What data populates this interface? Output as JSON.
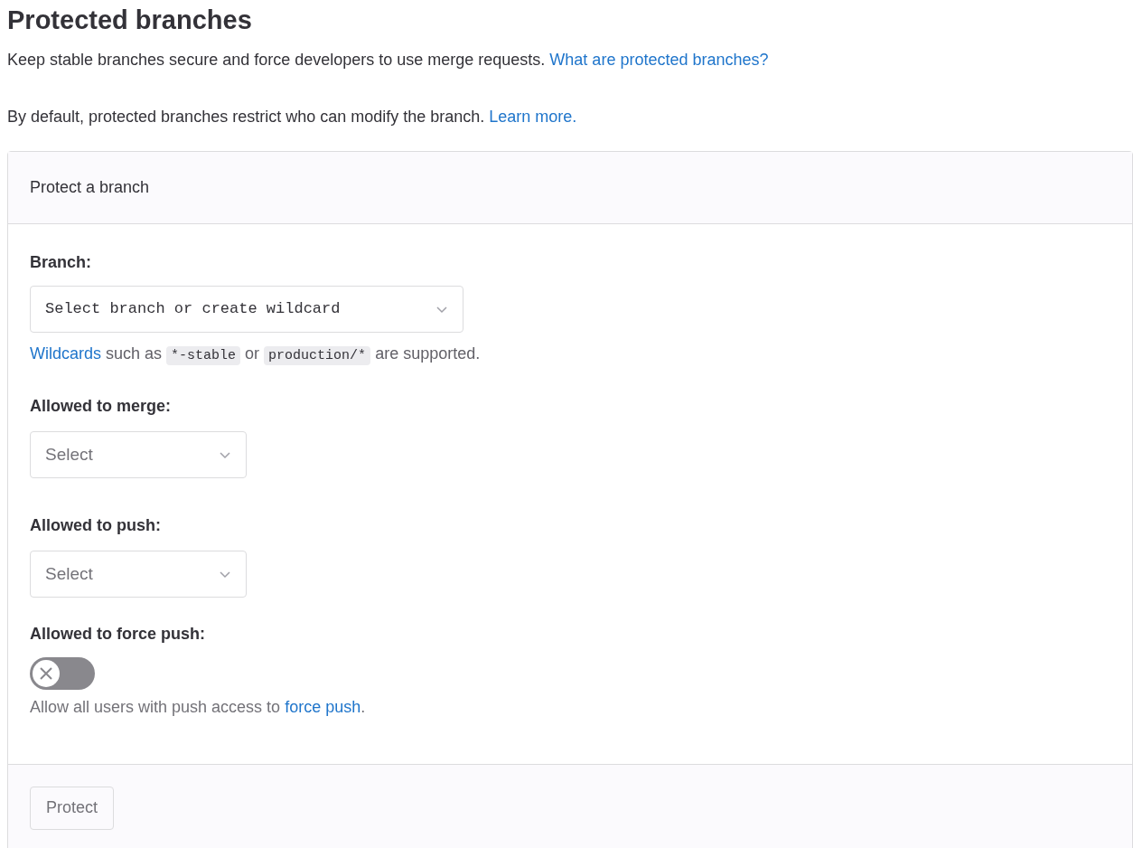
{
  "title": "Protected branches",
  "intro": [
    {
      "kind": "text",
      "text": "Keep stable branches secure and force developers to use merge requests. "
    },
    {
      "kind": "link",
      "text": "What are protected branches?"
    }
  ],
  "default_note": [
    {
      "kind": "text",
      "text": "By default, protected branches restrict who can modify the branch. "
    },
    {
      "kind": "link",
      "text": "Learn more."
    }
  ],
  "card": {
    "header": "Protect a branch",
    "branch": {
      "label": "Branch:",
      "placeholder": "Select branch or create wildcard",
      "hint": [
        {
          "kind": "link",
          "text": "Wildcards"
        },
        {
          "kind": "text",
          "text": " such as "
        },
        {
          "kind": "code",
          "text": "*-stable"
        },
        {
          "kind": "text",
          "text": " or "
        },
        {
          "kind": "code",
          "text": "production/*"
        },
        {
          "kind": "text",
          "text": " are supported."
        }
      ]
    },
    "selects": [
      {
        "label": "Allowed to merge:",
        "placeholder": "Select"
      },
      {
        "label": "Allowed to push:",
        "placeholder": "Select"
      }
    ],
    "force_push": {
      "label": "Allowed to force push:",
      "on": false,
      "hint": [
        {
          "kind": "text",
          "text": "Allow all users with push access to "
        },
        {
          "kind": "link",
          "text": "force push"
        },
        {
          "kind": "text",
          "text": "."
        }
      ]
    },
    "submit": {
      "label": "Protect",
      "disabled": true
    }
  }
}
